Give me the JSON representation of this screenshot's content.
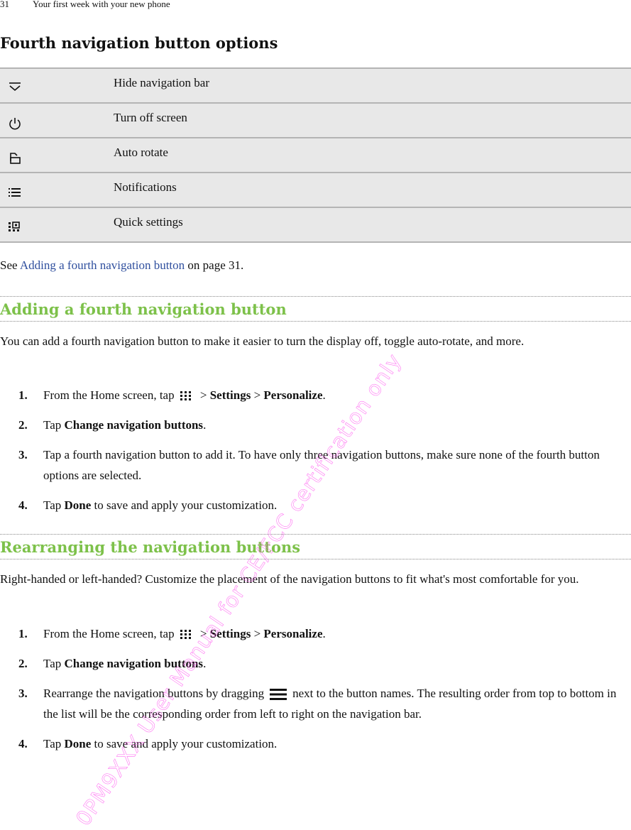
{
  "header": {
    "page_number": "31",
    "chapter": "Your first week with your new phone"
  },
  "page_title": "Fourth navigation button options",
  "options": [
    {
      "icon": "hide-navigation-bar-icon",
      "label": "Hide navigation bar"
    },
    {
      "icon": "power-icon",
      "label": "Turn off screen"
    },
    {
      "icon": "auto-rotate-icon",
      "label": "Auto rotate"
    },
    {
      "icon": "notifications-icon",
      "label": "Notifications"
    },
    {
      "icon": "quick-settings-icon",
      "label": "Quick settings"
    }
  ],
  "see_line": {
    "prefix": "See ",
    "link": "Adding a fourth navigation button",
    "suffix": " on page 31."
  },
  "section1": {
    "heading": "Adding a fourth navigation button",
    "intro": "You can add a fourth navigation button to make it easier to turn the display off, toggle auto-rotate, and more.",
    "steps": [
      {
        "num": "1.",
        "a": "From the Home screen, tap",
        "icon": "apps-icon",
        "b": " > ",
        "bold1": "Settings",
        "c": " > ",
        "bold2": "Personalize",
        "d": "."
      },
      {
        "num": "2.",
        "a": "Tap ",
        "bold1": "Change navigation buttons",
        "d": "."
      },
      {
        "num": "3.",
        "a": "Tap a fourth navigation button to add it. To have only three navigation buttons, make sure none of the fourth button options are selected."
      },
      {
        "num": "4.",
        "a": "Tap ",
        "bold1": "Done",
        "d": " to save and apply your customization."
      }
    ]
  },
  "section2": {
    "heading": "Rearranging the navigation buttons",
    "intro": "Right-handed or left-handed? Customize the placement of the navigation buttons to fit what's most comfortable for you.",
    "steps": [
      {
        "num": "1.",
        "a": "From the Home screen, tap",
        "icon": "apps-icon",
        "b": " > ",
        "bold1": "Settings",
        "c": " > ",
        "bold2": "Personalize",
        "d": "."
      },
      {
        "num": "2.",
        "a": "Tap ",
        "bold1": "Change navigation buttons",
        "d": "."
      },
      {
        "num": "3.",
        "a": "Rearrange the navigation buttons by dragging",
        "icon": "drag-handle-icon",
        "d": "next to the button names. The resulting order from top to bottom in the list will be the corresponding order from left to right on the navigation bar."
      },
      {
        "num": "4.",
        "a": "Tap ",
        "bold1": "Done",
        "d": " to save and apply your customization."
      }
    ]
  },
  "watermark": "0PM9XXX User Manual for CE/FCC certification only",
  "colors": {
    "heading_green": "#7dc14a",
    "link_blue": "#2f4f9e",
    "table_bg": "#e8e8e8",
    "watermark": "#ff5cf0"
  }
}
